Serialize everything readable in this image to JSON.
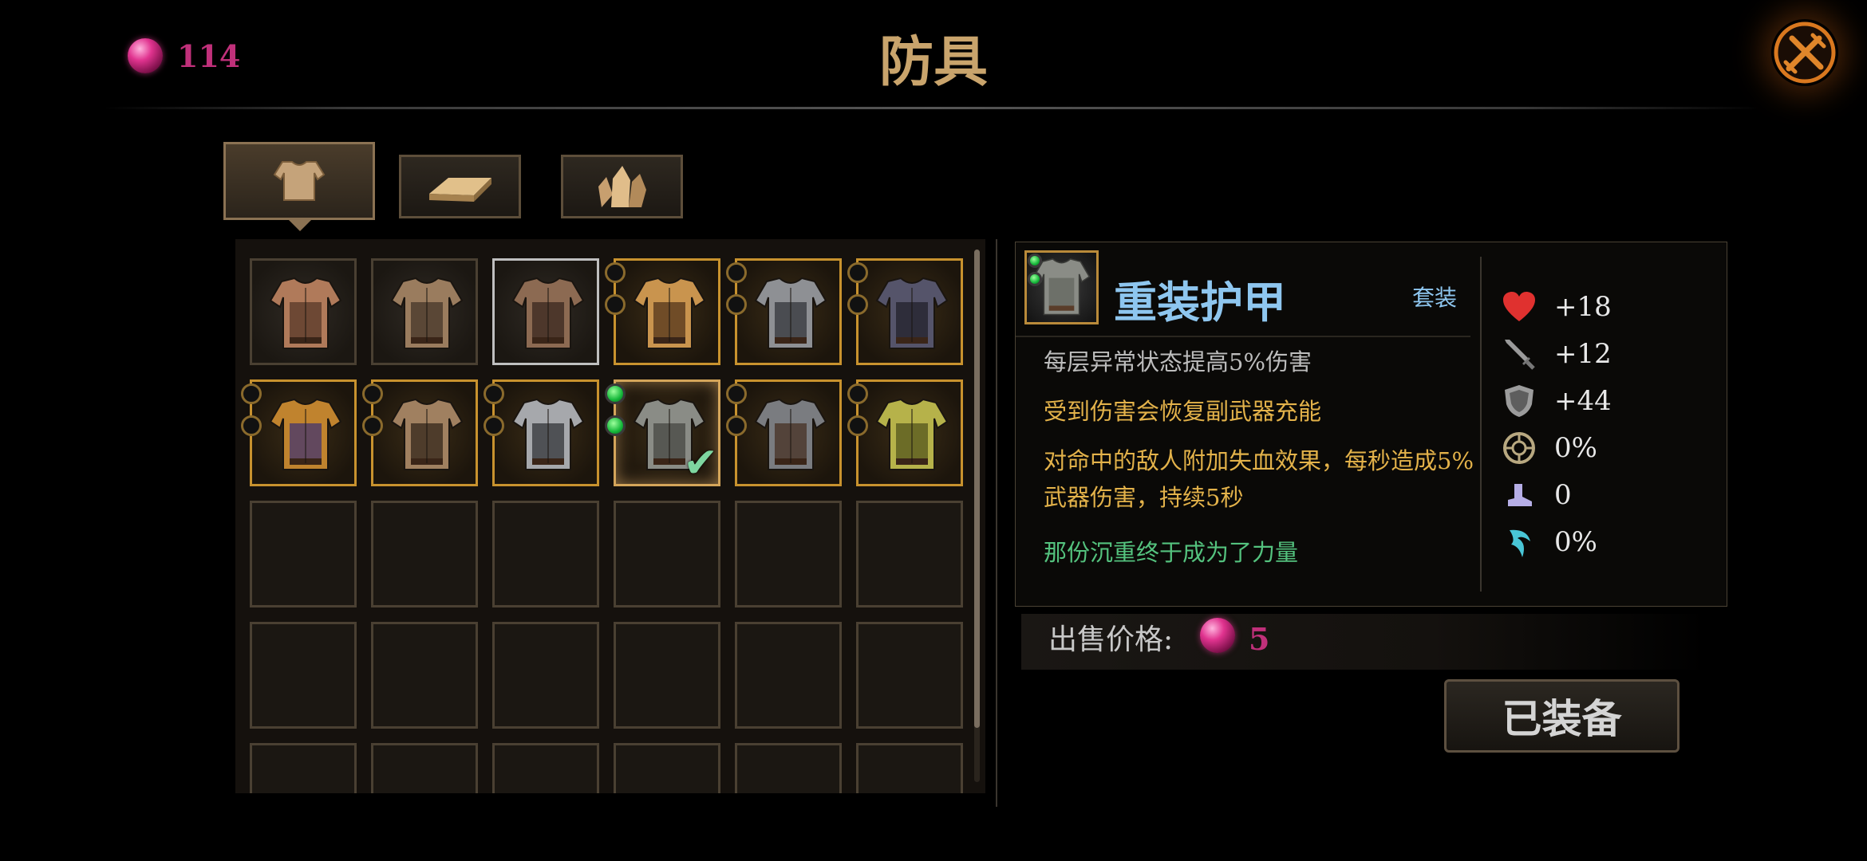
{
  "header": {
    "title": "防具",
    "currency": {
      "icon": "gem-icon",
      "amount": "114"
    }
  },
  "tabs": [
    {
      "name": "armor",
      "icon": "armor-icon",
      "selected": true
    },
    {
      "name": "ingot",
      "icon": "ingot-icon",
      "selected": false
    },
    {
      "name": "crystal",
      "icon": "crystal-icon",
      "selected": false
    }
  ],
  "inventory": {
    "items": [
      {
        "type": "leather-armor",
        "rarity": "common"
      },
      {
        "type": "plated-leather-armor",
        "rarity": "common"
      },
      {
        "type": "leather-coat-armor",
        "rarity": "silver"
      },
      {
        "type": "bronze-armor",
        "rarity": "gold"
      },
      {
        "type": "steel-armor",
        "rarity": "gold"
      },
      {
        "type": "dark-armor",
        "rarity": "gold"
      },
      {
        "type": "royal-armor",
        "rarity": "gold"
      },
      {
        "type": "hunter-armor",
        "rarity": "gold"
      },
      {
        "type": "knight-armor",
        "rarity": "gold"
      },
      {
        "type": "heavy-armor",
        "rarity": "gold",
        "equipped": true
      },
      {
        "type": "iron-armor",
        "rarity": "gold"
      },
      {
        "type": "thorn-armor",
        "rarity": "gold"
      }
    ]
  },
  "detail": {
    "name": "重装护甲",
    "set_label": "套装",
    "descriptions": [
      "每层异常状态提高5%伤害",
      "受到伤害会恢复副武器充能",
      "对命中的敌人附加失血效果，每秒造成5%武器伤害，持续5秒",
      "那份沉重终于成为了力量"
    ],
    "stats": [
      {
        "icon": "heart-icon",
        "value": "+18"
      },
      {
        "icon": "sword-icon",
        "value": "+12"
      },
      {
        "icon": "shield-icon",
        "value": "+44"
      },
      {
        "icon": "crit-icon",
        "value": "0%"
      },
      {
        "icon": "boot-icon",
        "value": "0"
      },
      {
        "icon": "claw-icon",
        "value": "0%"
      }
    ],
    "sell_label": "出售价格:",
    "sell_price": "5",
    "equip_label": "已装备"
  },
  "colors": {
    "title": "#c9a46c",
    "currency": "#c0307a",
    "item_name": "#8ec6ef",
    "effect": "#e3b24a",
    "flavor": "#54c27e",
    "gold_border": "#c8922e"
  }
}
